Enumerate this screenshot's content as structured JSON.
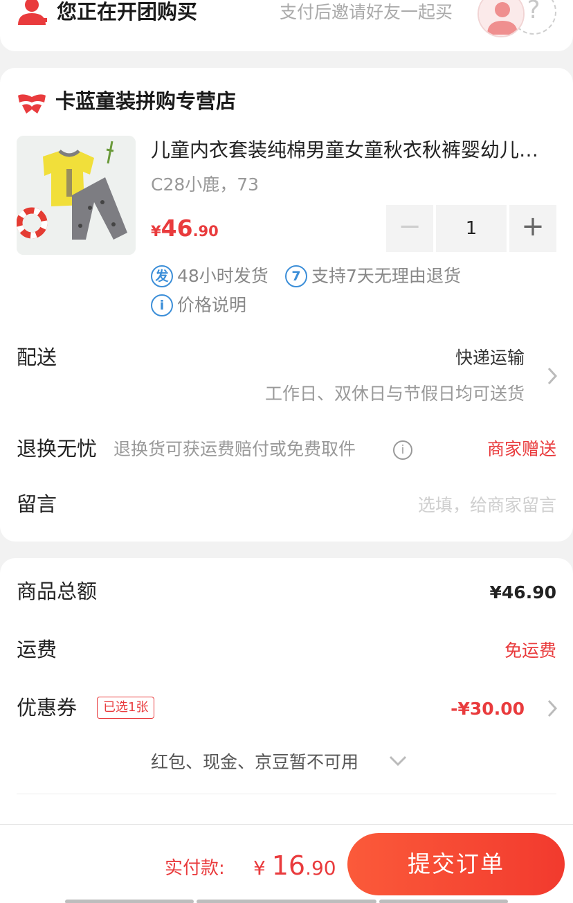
{
  "group_buy": {
    "title": "您正在开团购买",
    "hint": "支付后邀请好友一起买",
    "empty_slot_symbol": "?",
    "accent_color": "#e93b3d"
  },
  "store": {
    "name": "卡蓝童装拼购专营店"
  },
  "product": {
    "title": "儿童内衣套装纯棉男童女童秋衣秋裤婴幼儿宝宝衣服套装",
    "spec": "C28小鹿，73",
    "price_symbol": "¥",
    "price_int": "46",
    "price_dec": ".90",
    "quantity": "1",
    "minus_symbol": "−",
    "plus_symbol": "+"
  },
  "services": {
    "shipping_badge": "发",
    "shipping_text": "48小时发货",
    "return_badge": "7",
    "return_text": "支持7天无理由退货",
    "price_badge": "i",
    "price_text": "价格说明"
  },
  "delivery": {
    "label": "配送",
    "method": "快递运输",
    "note": "工作日、双休日与节假日均可送货"
  },
  "return_service": {
    "label": "退换无忧",
    "desc": "退换货可获运费赔付或免费取件",
    "info_symbol": "i",
    "gift": "商家赠送"
  },
  "message": {
    "label": "留言",
    "placeholder": "选填，给商家留言"
  },
  "summary": {
    "subtotal_label": "商品总额",
    "subtotal_value": "¥46.90",
    "shipping_label": "运费",
    "shipping_value": "免运费",
    "coupon_label": "优惠券",
    "coupon_badge": "已选1张",
    "coupon_value": "-¥30.00",
    "wallet_note": "红包、现金、京豆暂不可用"
  },
  "footer": {
    "total_label": "实付款:",
    "total_symbol": "¥ ",
    "total_int": "16",
    "total_dec": ".90",
    "submit_label": "提交订单"
  }
}
